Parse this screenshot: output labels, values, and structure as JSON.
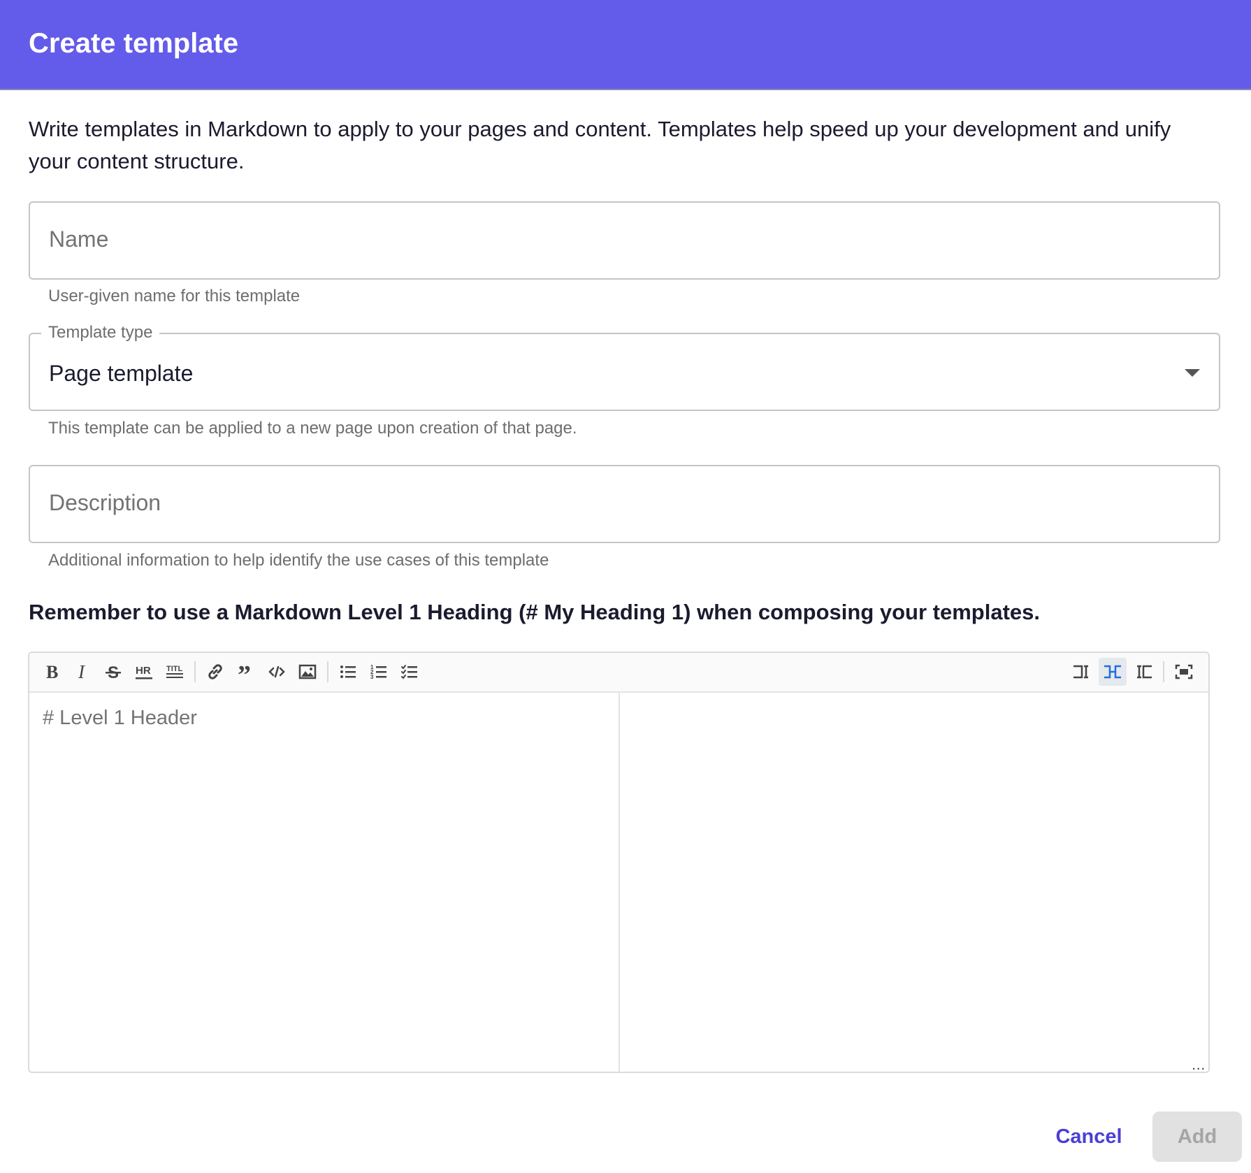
{
  "dialog": {
    "title": "Create template"
  },
  "intro_text": "Write templates in Markdown to apply to your pages and content. Templates help speed up your development and unify your content structure.",
  "name_field": {
    "placeholder": "Name",
    "helper": "User-given name for this template"
  },
  "template_type_field": {
    "label": "Template type",
    "value": "Page template",
    "helper": "This template can be applied to a new page upon creation of that page."
  },
  "description_field": {
    "placeholder": "Description",
    "helper": "Additional information to help identify the use cases of this template"
  },
  "reminder_text": "Remember to use a Markdown Level 1 Heading (# My Heading 1) when composing your templates.",
  "editor": {
    "placeholder": "# Level 1 Header",
    "toolbar": [
      {
        "icon": "bold-icon"
      },
      {
        "icon": "italic-icon"
      },
      {
        "icon": "strikethrough-icon"
      },
      {
        "icon": "horizontal-rule-icon"
      },
      {
        "icon": "title-icon"
      },
      {
        "icon": "link-icon"
      },
      {
        "icon": "quote-icon"
      },
      {
        "icon": "code-icon"
      },
      {
        "icon": "image-icon"
      },
      {
        "icon": "bulleted-list-icon"
      },
      {
        "icon": "numbered-list-icon"
      },
      {
        "icon": "checklist-icon"
      },
      {
        "icon": "editor-only-icon"
      },
      {
        "icon": "side-by-side-icon",
        "active": true
      },
      {
        "icon": "preview-only-icon"
      },
      {
        "icon": "fullscreen-icon"
      }
    ],
    "resize_handle": "..."
  },
  "actions": {
    "cancel_label": "Cancel",
    "add_label": "Add"
  },
  "colors": {
    "header_bg": "#635be9",
    "accent": "#4a3fd6",
    "active_tool": "#1f6fe0",
    "disabled_bg": "#e1e1e1"
  }
}
